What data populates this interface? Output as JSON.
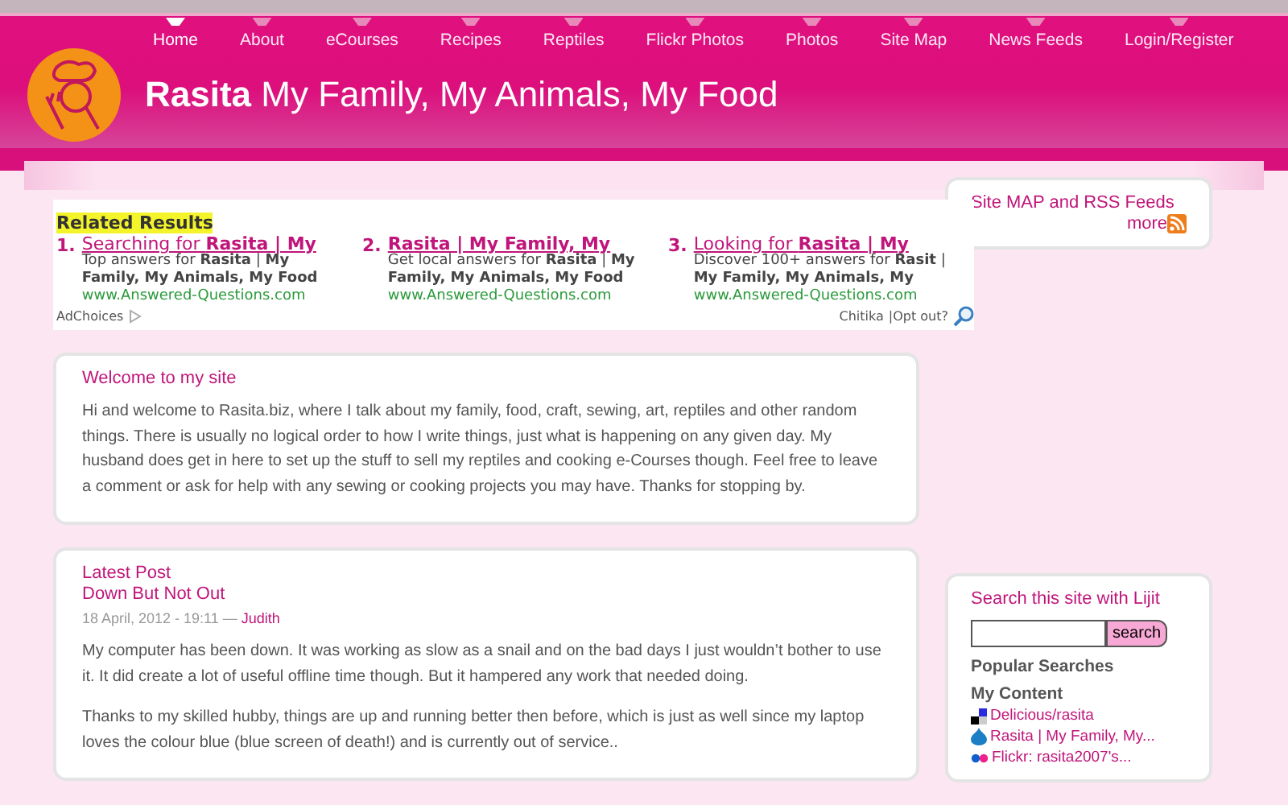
{
  "nav": [
    {
      "label": "Home",
      "selected": true
    },
    {
      "label": "About",
      "selected": false
    },
    {
      "label": "eCourses",
      "selected": false
    },
    {
      "label": "Recipes",
      "selected": false
    },
    {
      "label": "Reptiles",
      "selected": false
    },
    {
      "label": "Flickr Photos",
      "selected": false
    },
    {
      "label": "Photos",
      "selected": false
    },
    {
      "label": "Site Map",
      "selected": false
    },
    {
      "label": "News Feeds",
      "selected": false
    },
    {
      "label": "Login/Register",
      "selected": false
    }
  ],
  "site_title": {
    "name": "Rasita",
    "tagline": "My Family, My Animals, My Food"
  },
  "related_results": {
    "heading": "Related Results",
    "items": [
      {
        "number": "1.",
        "title": "Searching for **Rasita | My**",
        "description": "Top answers for **Rasita** | **My Family, My Animals, My Food**",
        "url": "www.Answered-Questions.com"
      },
      {
        "number": "2.",
        "title": "**Rasita | My Family, My**",
        "description": "Get local answers for **Rasita** | **My Family, My Animals, My Food**",
        "url": "www.Answered-Questions.com"
      },
      {
        "number": "3.",
        "title": "Looking for **Rasita | My**",
        "description": "Discover 100+ answers for **Rasit** | **My Family, My Animals, My**",
        "url": "www.Answered-Questions.com"
      }
    ],
    "adchoices": "AdChoices",
    "provider": "Chitika",
    "opt_out": "|Opt out?"
  },
  "welcome": {
    "heading": "Welcome to my site",
    "text": "Hi and welcome to Rasita.biz, where I talk about my family, food, craft, sewing, art, reptiles and other random things. There is usually no logical order to how I write things, just what is happening on any given day. My husband does get in here to set up the stuff to sell my reptiles and cooking e-Courses though. Feel free to leave a comment or ask for help with any sewing or cooking projects you may have. Thanks for stopping by."
  },
  "latest_post": {
    "heading": "Latest Post",
    "title": "Down But Not Out",
    "date": "18 April, 2012 - 19:11 —",
    "author": "Judith",
    "paragraphs": [
      "My computer has been down. It was working as slow as a snail and on the bad days I just wouldn’t bother to use it. It did create a lot of useful offline time though. But it hampered any work that needed doing.",
      "Thanks to my skilled hubby, things are up and running better then before, which is just as well since my laptop loves the colour blue (blue screen of death!) and is currently out of service.."
    ]
  },
  "sitemap": {
    "title": "Site MAP and RSS Feeds",
    "more": "more"
  },
  "search": {
    "heading": "Search this site with Lijit",
    "button": "search",
    "popular": "Popular Searches",
    "my_content": "My Content",
    "links": [
      {
        "kind": "delicious",
        "label": "Delicious/rasita"
      },
      {
        "kind": "drupal",
        "label": "Rasita | My Family, My..."
      },
      {
        "kind": "flickr",
        "label": "Flickr: rasita2007's..."
      }
    ]
  }
}
